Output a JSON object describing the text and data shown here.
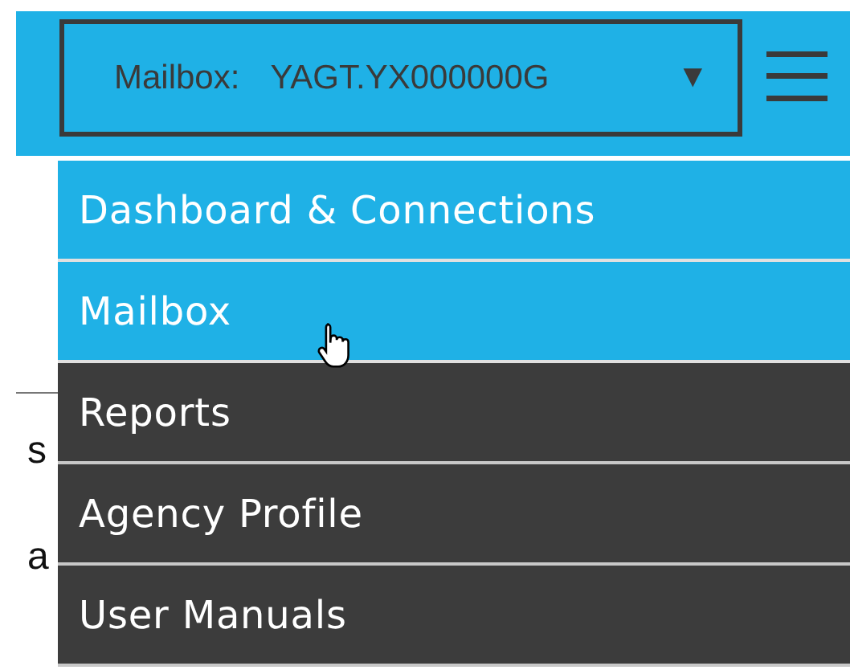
{
  "header": {
    "mailbox_select": {
      "label": "Mailbox:",
      "value": "YAGT.YX000000G",
      "caret": "▼"
    }
  },
  "background_text": [
    "s",
    "a"
  ],
  "menu": {
    "items": [
      {
        "label": "Dashboard & Connections",
        "highlighted": true
      },
      {
        "label": "Mailbox",
        "highlighted": true
      },
      {
        "label": "Reports",
        "highlighted": false
      },
      {
        "label": "Agency Profile",
        "highlighted": false
      },
      {
        "label": "User Manuals",
        "highlighted": false
      }
    ]
  }
}
